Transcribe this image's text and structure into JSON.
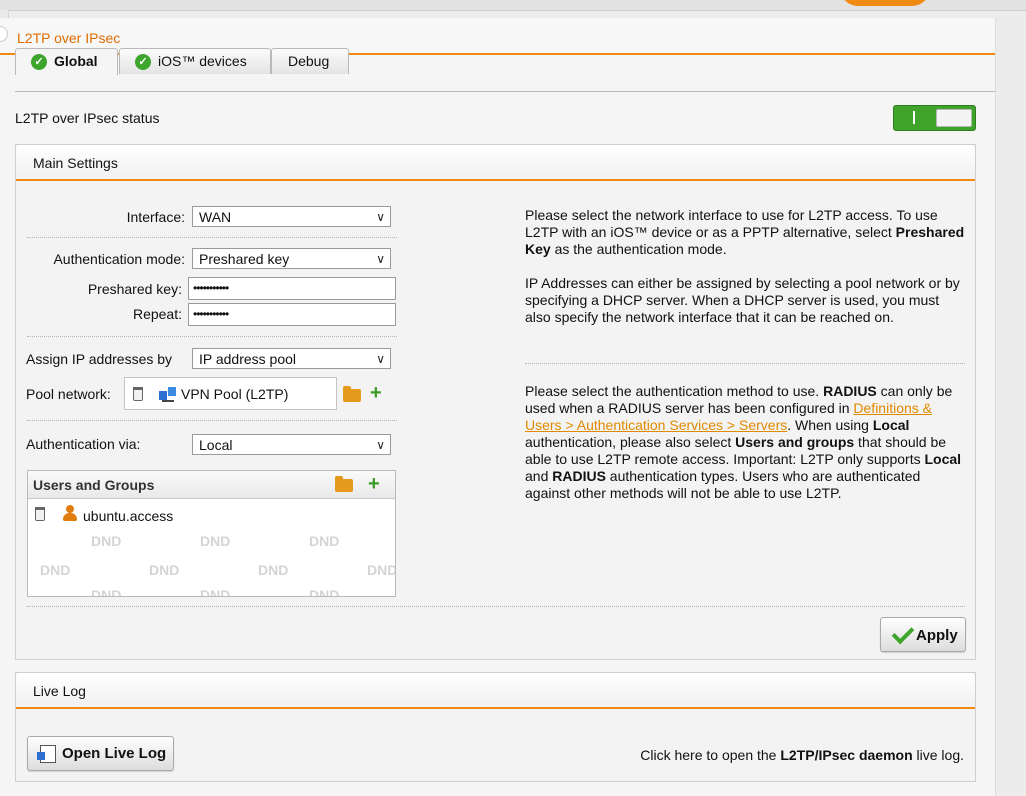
{
  "panel": {
    "title": "L2TP over IPsec"
  },
  "tabs": [
    {
      "label": "Global",
      "checked": true,
      "active": true
    },
    {
      "label": "iOS™ devices",
      "checked": true,
      "active": false
    },
    {
      "label": "Debug",
      "checked": false,
      "active": false
    }
  ],
  "status": {
    "label": "L2TP over IPsec status",
    "enabled": true
  },
  "main_settings": {
    "header": "Main Settings",
    "interface": {
      "label": "Interface:",
      "value": "WAN"
    },
    "auth_mode": {
      "label": "Authentication mode:",
      "value": "Preshared key"
    },
    "preshared_key": {
      "label": "Preshared key:",
      "value": "•••••••••••"
    },
    "repeat": {
      "label": "Repeat:",
      "value": "•••••••••••"
    },
    "assign_ip": {
      "label": "Assign IP addresses by",
      "value": "IP address pool"
    },
    "pool_network": {
      "label": "Pool network:",
      "value": "VPN Pool (L2TP)"
    },
    "auth_via": {
      "label": "Authentication via:",
      "value": "Local"
    },
    "users_groups": {
      "header": "Users and Groups",
      "items": [
        "ubuntu.access"
      ],
      "dnd_label": "DND"
    },
    "help": {
      "p1_a": "Please select the network interface to use for L2TP access. To use L2TP with an iOS™ device or as a PPTP alternative, select ",
      "p1_b": "Preshared Key",
      "p1_c": " as the authentication mode.",
      "p2": "IP Addresses can either be assigned by selecting a pool network or by specifying a DHCP server. When a DHCP server is used, you must also specify the network interface that it can be reached on.",
      "p3_a": "Please select the authentication method to use. ",
      "p3_b": "RADIUS",
      "p3_c": " can only be used when a RADIUS server has been configured in ",
      "p3_link": "Definitions & Users > Authentication Services > Servers",
      "p3_d": ". When using ",
      "p3_e": "Local",
      "p3_f": " authentication, please also select ",
      "p3_g": "Users and groups",
      "p3_h": " that should be able to use L2TP remote access. Important: L2TP only supports ",
      "p3_i": "Local",
      "p3_j": " and ",
      "p3_k": "RADIUS",
      "p3_l": " authentication types. Users who are authenticated against other methods will not be able to use L2TP."
    },
    "apply_label": "Apply"
  },
  "live_log": {
    "header": "Live Log",
    "button_label": "Open Live Log",
    "hint_a": "Click here to open the ",
    "hint_b": "L2TP/IPsec daemon",
    "hint_c": " live log."
  },
  "colors": {
    "accent": "#f08a12",
    "green": "#3ea52c",
    "link": "#e08a00"
  }
}
